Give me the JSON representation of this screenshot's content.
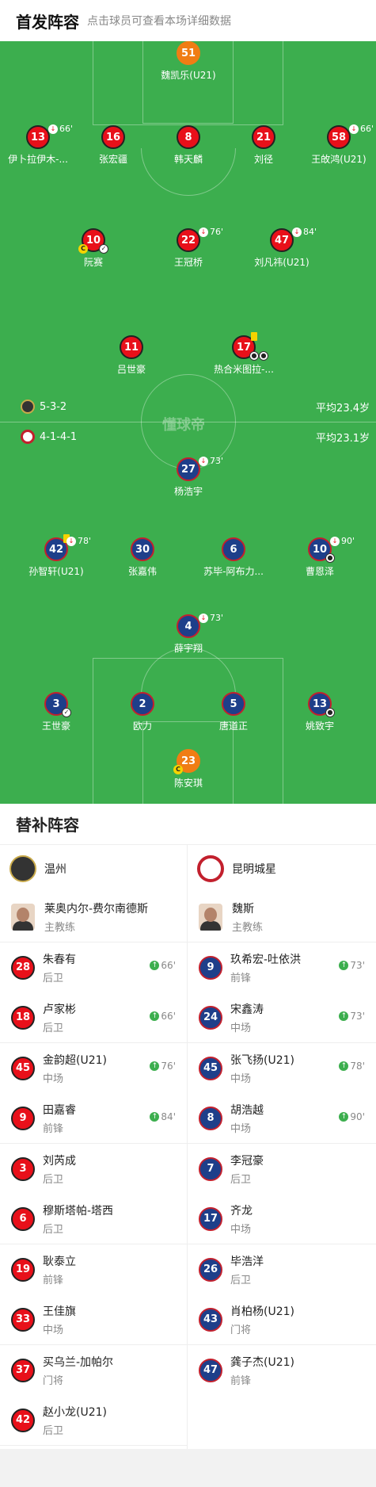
{
  "header": {
    "title": "首发阵容",
    "hint": "点击球员可查看本场详细数据"
  },
  "pitch": {
    "watermark": "懂球帝",
    "home": {
      "formation": "5-3-2",
      "avg_age": "平均23.4岁"
    },
    "away": {
      "formation": "4-1-4-1",
      "avg_age": "平均23.1岁"
    }
  },
  "home_players": [
    {
      "num": "51",
      "name": "魏凯乐(U21)",
      "color": "orange"
    },
    {
      "num": "13",
      "name": "伊卜拉伊木-...",
      "sub_time": "66'"
    },
    {
      "num": "16",
      "name": "张宏疆"
    },
    {
      "num": "8",
      "name": "韩天麟"
    },
    {
      "num": "21",
      "name": "刘径"
    },
    {
      "num": "58",
      "name": "王敀鸿(U21)",
      "sub_time": "66'"
    },
    {
      "num": "10",
      "name": "阮赛"
    },
    {
      "num": "22",
      "name": "王冠桥",
      "sub_time": "76'"
    },
    {
      "num": "47",
      "name": "刘凡祎(U21)",
      "sub_time": "84'"
    },
    {
      "num": "11",
      "name": "吕世豪"
    },
    {
      "num": "17",
      "name": "热合米图拉-..."
    }
  ],
  "away_players": [
    {
      "num": "27",
      "name": "杨浩宇",
      "sub_time": "73'"
    },
    {
      "num": "42",
      "name": "孙智轩(U21)",
      "sub_time": "78'"
    },
    {
      "num": "30",
      "name": "张嘉伟"
    },
    {
      "num": "6",
      "name": "苏毕-阿布力..."
    },
    {
      "num": "10",
      "name": "曹恩泽",
      "sub_time": "90'"
    },
    {
      "num": "4",
      "name": "薛宇翔",
      "sub_time": "73'"
    },
    {
      "num": "3",
      "name": "王世豪"
    },
    {
      "num": "2",
      "name": "欧力"
    },
    {
      "num": "5",
      "name": "唐道正"
    },
    {
      "num": "13",
      "name": "姚致宇"
    },
    {
      "num": "23",
      "name": "陈安琪",
      "color": "orange"
    }
  ],
  "subs": {
    "title": "替补阵容",
    "home": {
      "team": "温州",
      "coach": {
        "name": "莱奥内尔-费尔南德斯",
        "role": "主教练"
      },
      "players": [
        {
          "num": "28",
          "name": "朱春有",
          "pos": "后卫",
          "in": "66'"
        },
        {
          "num": "18",
          "name": "卢家彬",
          "pos": "后卫",
          "in": "66'"
        },
        {
          "num": "45",
          "name": "金韵超(U21)",
          "pos": "中场",
          "in": "76'"
        },
        {
          "num": "9",
          "name": "田嘉睿",
          "pos": "前锋",
          "in": "84'"
        },
        {
          "num": "3",
          "name": "刘芮成",
          "pos": "后卫"
        },
        {
          "num": "6",
          "name": "穆斯塔帕-塔西",
          "pos": "后卫"
        },
        {
          "num": "19",
          "name": "耿泰立",
          "pos": "前锋"
        },
        {
          "num": "33",
          "name": "王佳旗",
          "pos": "中场"
        },
        {
          "num": "37",
          "name": "买乌兰-加帕尔",
          "pos": "门将"
        },
        {
          "num": "42",
          "name": "赵小龙(U21)",
          "pos": "后卫"
        }
      ]
    },
    "away": {
      "team": "昆明城星",
      "coach": {
        "name": "魏斯",
        "role": "主教练"
      },
      "players": [
        {
          "num": "9",
          "name": "玖希宏-吐依洪",
          "pos": "前锋",
          "in": "73'"
        },
        {
          "num": "24",
          "name": "宋鑫涛",
          "pos": "中场",
          "in": "73'"
        },
        {
          "num": "45",
          "name": "张飞扬(U21)",
          "pos": "中场",
          "in": "78'"
        },
        {
          "num": "8",
          "name": "胡浩越",
          "pos": "中场",
          "in": "90'"
        },
        {
          "num": "7",
          "name": "李冠豪",
          "pos": "后卫"
        },
        {
          "num": "17",
          "name": "齐龙",
          "pos": "中场"
        },
        {
          "num": "26",
          "name": "毕浩洋",
          "pos": "后卫"
        },
        {
          "num": "43",
          "name": "肖柏杨(U21)",
          "pos": "门将"
        },
        {
          "num": "47",
          "name": "龚子杰(U21)",
          "pos": "前锋"
        }
      ]
    }
  }
}
